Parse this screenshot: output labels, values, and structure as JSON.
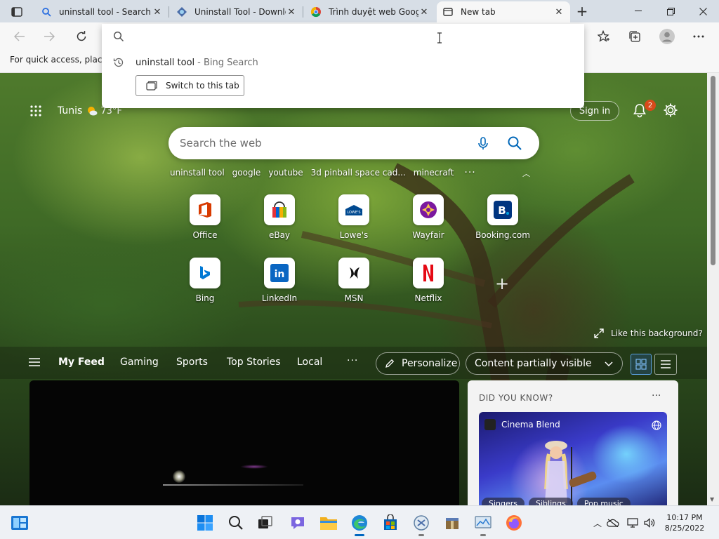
{
  "tabs": [
    {
      "title": "uninstall tool - Search",
      "icon": "search-icon",
      "active": false
    },
    {
      "title": "Uninstall Tool - Downlo",
      "icon": "download-site-icon",
      "active": false
    },
    {
      "title": "Trình duyệt web Googl",
      "icon": "chrome-icon",
      "active": false
    },
    {
      "title": "New tab",
      "icon": "newtab-icon",
      "active": true
    }
  ],
  "favorites_bar": {
    "text": "For quick access, place y"
  },
  "omnibox": {
    "value": "",
    "suggestion": {
      "text": "uninstall tool",
      "source": " - Bing Search"
    },
    "switch_label": "Switch to this tab"
  },
  "ntp": {
    "location": "Tunis",
    "temperature": "73°F",
    "signin_label": "Sign in",
    "notification_count": "2",
    "search_placeholder": "Search the web",
    "trending": [
      "uninstall tool",
      "google",
      "youtube",
      "3d pinball space cad...",
      "minecraft"
    ],
    "tiles": [
      {
        "label": "Office",
        "icon": "office-icon",
        "color": "#d83b01"
      },
      {
        "label": "eBay",
        "icon": "ebay-icon",
        "color": "#0064d2"
      },
      {
        "label": "Lowe's",
        "icon": "lowes-icon",
        "color": "#004990"
      },
      {
        "label": "Wayfair",
        "icon": "wayfair-icon",
        "color": "#7b189f"
      },
      {
        "label": "Booking.com",
        "icon": "booking-icon",
        "color": "#003580"
      },
      {
        "label": "Bing",
        "icon": "bing-icon",
        "color": "#0078d4"
      },
      {
        "label": "LinkedIn",
        "icon": "linkedin-icon",
        "color": "#0a66c2"
      },
      {
        "label": "MSN",
        "icon": "msn-icon",
        "color": "#000000"
      },
      {
        "label": "Netflix",
        "icon": "netflix-icon",
        "color": "#e50914"
      }
    ],
    "like_background": "Like this background?"
  },
  "feed": {
    "tabs": [
      "My Feed",
      "Gaming",
      "Sports",
      "Top Stories",
      "Local"
    ],
    "personalize_label": "Personalize",
    "content_select_value": "Content partially visible",
    "did_you_know": {
      "title": "DID YOU KNOW?",
      "source": "Cinema Blend",
      "chips": [
        "Singers",
        "Siblings",
        "Pop music"
      ]
    }
  },
  "taskbar": {
    "apps": [
      "widgets-icon",
      "windows-start-icon",
      "search-icon",
      "task-view-icon",
      "chat-icon",
      "file-explorer-icon",
      "edge-icon",
      "store-icon",
      "uninstaller-icon",
      "archive-icon",
      "monitor-icon",
      "firefox-icon"
    ],
    "time": "10:17 PM",
    "date": "8/25/2022"
  }
}
